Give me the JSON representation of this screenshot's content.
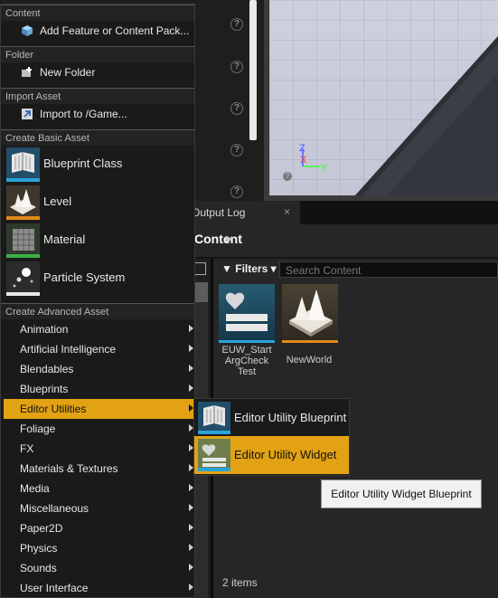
{
  "background": {
    "output_tab_label": "Output Log",
    "output_tab_close": "×",
    "content_title": "Content",
    "filters_label": "Filters",
    "search_placeholder": "Search Content",
    "assets": [
      {
        "label": "EUW_Start\nArgCheck\nTest",
        "icon": "editor-utility-widget-icon"
      },
      {
        "label": "NewWorld",
        "icon": "level-icon"
      }
    ],
    "item_count": "2 items",
    "gizmo": {
      "z": "Z",
      "x": "X",
      "y": "Y"
    },
    "help_glyph": "?"
  },
  "menu": {
    "content_header": "Content",
    "add_feature": "Add Feature or Content Pack...",
    "folder_header": "Folder",
    "new_folder": "New Folder",
    "import_header": "Import Asset",
    "import_to_game": "Import to /Game...",
    "basic_header": "Create Basic Asset",
    "basic_assets": [
      "Blueprint Class",
      "Level",
      "Material",
      "Particle System"
    ],
    "advanced_header": "Create Advanced Asset",
    "advanced_items": [
      "Animation",
      "Artificial Intelligence",
      "Blendables",
      "Blueprints",
      "Editor Utilities",
      "Foliage",
      "FX",
      "Materials & Textures",
      "Media",
      "Miscellaneous",
      "Paper2D",
      "Physics",
      "Sounds",
      "User Interface"
    ],
    "active_item": "Editor Utilities"
  },
  "submenu": {
    "items": [
      "Editor Utility Blueprint",
      "Editor Utility Widget"
    ],
    "highlighted": "Editor Utility Widget"
  },
  "tooltip": "Editor Utility Widget Blueprint",
  "colors": {
    "highlight": "#e2a213",
    "menu_bg": "#1a1a1a",
    "widget_blue": "#2aa3d9",
    "level_orange": "#e08a1a"
  }
}
